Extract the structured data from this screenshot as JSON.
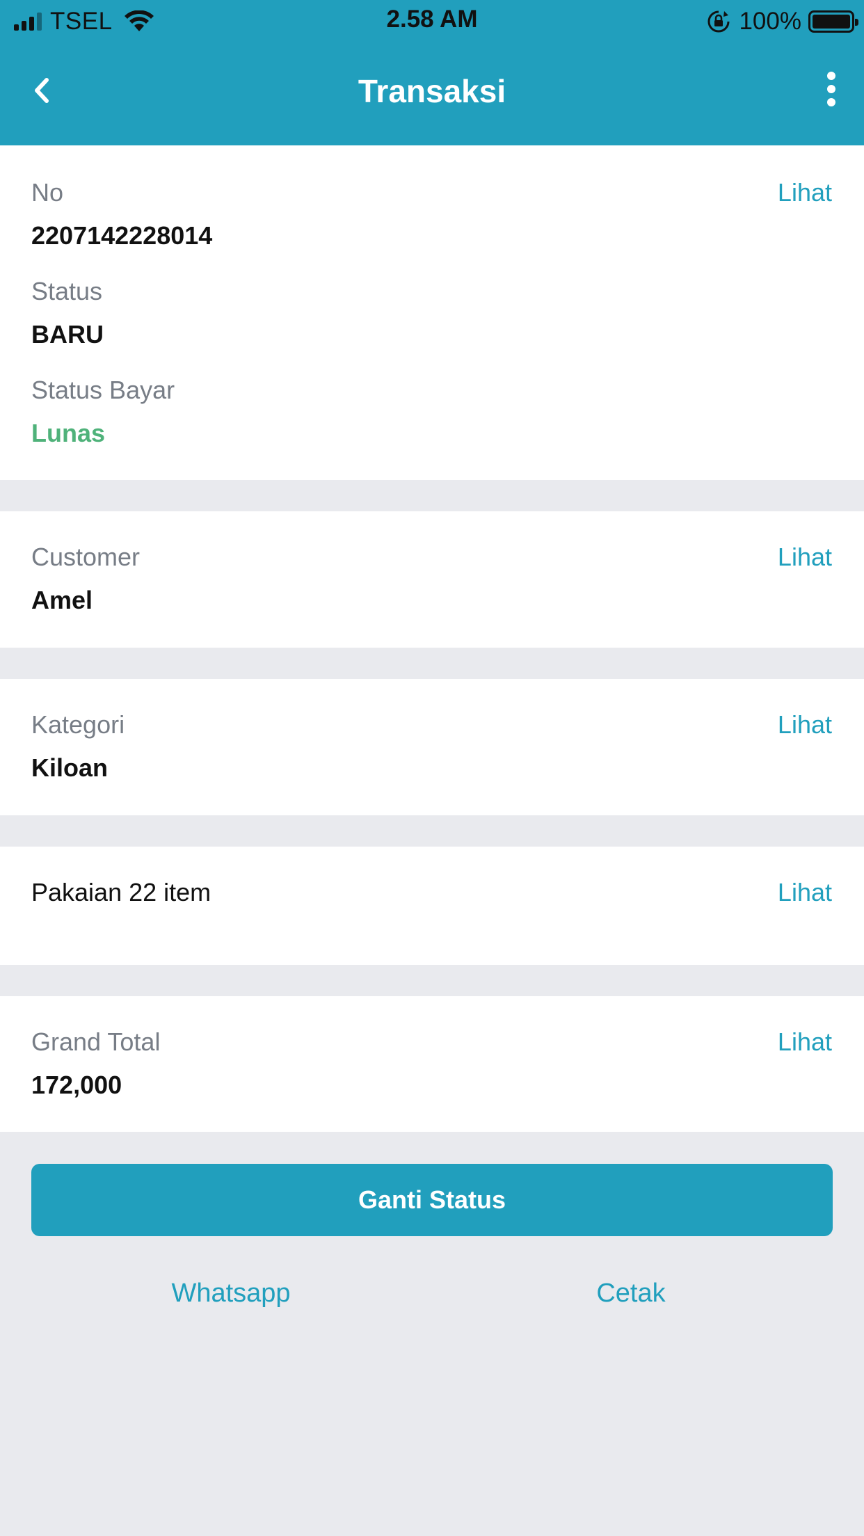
{
  "status_bar": {
    "carrier": "TSEL",
    "time": "2.58 AM",
    "battery": "100%"
  },
  "header": {
    "title": "Transaksi"
  },
  "transaction": {
    "no_label": "No",
    "no_value": "2207142228014",
    "status_label": "Status",
    "status_value": "BARU",
    "pay_status_label": "Status Bayar",
    "pay_status_value": "Lunas"
  },
  "customer": {
    "label": "Customer",
    "value": "Amel"
  },
  "category": {
    "label": "Kategori",
    "value": "Kiloan"
  },
  "items": {
    "text": "Pakaian 22 item"
  },
  "total": {
    "label": "Grand Total",
    "value": "172,000"
  },
  "lihat_label": "Lihat",
  "actions": {
    "change_status": "Ganti Status",
    "whatsapp": "Whatsapp",
    "print": "Cetak"
  },
  "colors": {
    "primary": "#219fbd",
    "paid_green": "#4fb27a",
    "background": "#e9eaee"
  },
  "icons": {
    "back": "chevron-left-icon",
    "more": "more-vertical-icon",
    "wifi": "wifi-icon",
    "orientation_lock": "orientation-lock-icon",
    "battery": "battery-icon",
    "signal": "signal-icon"
  }
}
